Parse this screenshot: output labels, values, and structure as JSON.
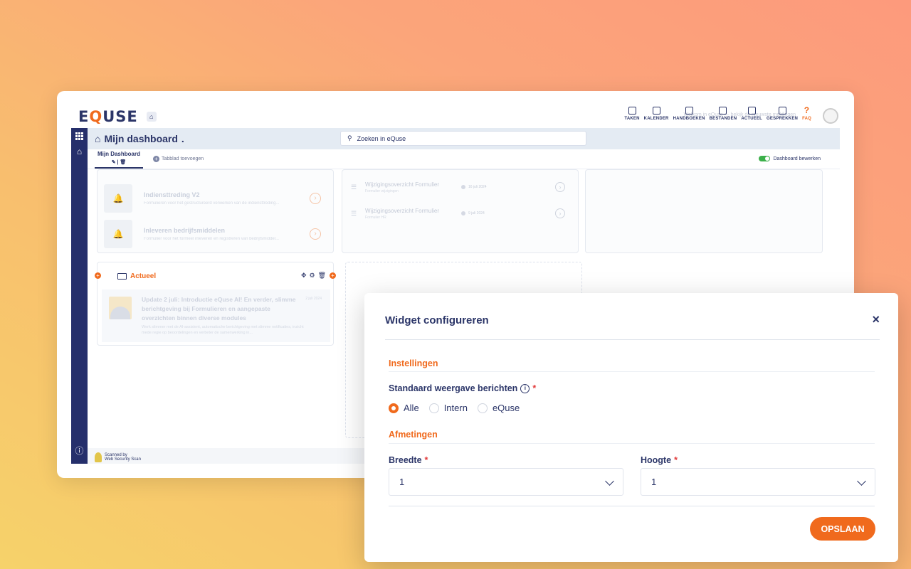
{
  "app": {
    "logo": {
      "e": "E",
      "q": "Q",
      "rest": "USE"
    },
    "nav": [
      {
        "label": "TAKEN",
        "icon": "clipboard-icon"
      },
      {
        "label": "KALENDER",
        "icon": "calendar-icon"
      },
      {
        "label": "HANDBOEKEN",
        "icon": "book-icon"
      },
      {
        "label": "BESTANDEN",
        "icon": "archive-icon"
      },
      {
        "label": "ACTUEEL",
        "icon": "news-icon"
      },
      {
        "label": "GESPREKKEN",
        "icon": "chat-icon"
      },
      {
        "label": "FAQ",
        "icon": "question-icon"
      }
    ],
    "notice": "Welkom in eQuse — bekijk de nieuwste meldingen",
    "dashboard_title": "Mijn dashboard",
    "search_placeholder": "Zoeken in eQuse",
    "tab_active": "Mijn Dashboard",
    "tab_add": "Tabblad toevoegen",
    "edit_toggle": "Dashboard bewerken",
    "footer": {
      "line1": "Scanned by",
      "line2": "Web Security Scan"
    }
  },
  "widgets": {
    "card1": [
      {
        "title": "Indiensttreding V2",
        "sub": "Formulieren voor het gestructureerd verwerken van de indiensttreding..."
      },
      {
        "title": "Inleveren bedrijfsmiddelen",
        "sub": "Formulier voor het formeel inleveren en registreren van bedrijfsmiddel..."
      }
    ],
    "card2": [
      {
        "title": "Wijzigingsoverzicht Formulier",
        "sub": "Formulier wijzigingen",
        "date": "16 juli 2024"
      },
      {
        "title": "Wijzigingsoverzicht Formulier",
        "sub": "Formulier HR",
        "date": "9 juli 2024"
      }
    ],
    "actueel": {
      "title": "Actueel",
      "item_title": "Update 2 juli: Introductie eQuse AI! En verder, slimme berichtgeving bij Formulieren en aangepaste overzichten binnen diverse modules",
      "item_sub": "Werk slimmer met de AI-assistent, automatische berichtgeving met slimme notificaties, inzicht mede regie op beoordelingen en verbeter de samenwerking in...",
      "item_date": "2 juli 2024"
    }
  },
  "modal": {
    "title": "Widget configureren",
    "section_settings": "Instellingen",
    "field_default_view": "Standaard weergave berichten",
    "radio_options": [
      "Alle",
      "Intern",
      "eQuse"
    ],
    "radio_selected": "Alle",
    "section_dimensions": "Afmetingen",
    "width_label": "Breedte",
    "width_value": "1",
    "height_label": "Hoogte",
    "height_value": "1",
    "save_label": "OPSLAAN",
    "required_mark": "*"
  },
  "colors": {
    "accent": "#f06a1d",
    "navy": "#2b3568",
    "sidebar": "#252f6b"
  }
}
